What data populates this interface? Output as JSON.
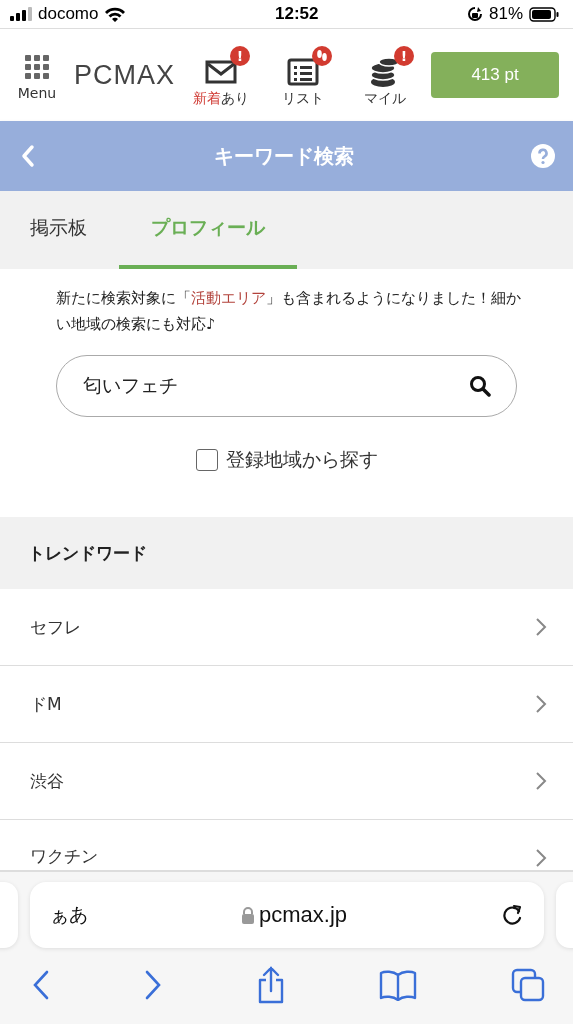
{
  "status_bar": {
    "carrier": "docomo",
    "time": "12:52",
    "battery": "81%"
  },
  "header": {
    "menu_label": "Menu",
    "logo": "PCMAX",
    "nav": [
      {
        "kind": "mail",
        "label_highlight": "新着",
        "label": "あり",
        "badge": "!"
      },
      {
        "kind": "list",
        "label": "リスト",
        "footprint_badge": true
      },
      {
        "kind": "coins",
        "label": "マイル",
        "badge": "!"
      }
    ],
    "points_button": "413 pt"
  },
  "title_bar": {
    "title": "キーワード検索"
  },
  "tabs": [
    {
      "label": "掲示板",
      "selected": false
    },
    {
      "label": "プロフィール",
      "selected": true
    }
  ],
  "notice": [
    {
      "text": "新たに検索対象に「",
      "emphasis": false
    },
    {
      "text": "活動エリア",
      "emphasis": true
    },
    {
      "text": "」も含まれるようになりました！細かい地域の検索にも対応♪",
      "emphasis": false
    }
  ],
  "search": {
    "value": "匂いフェチ"
  },
  "region_checkbox": {
    "label": "登録地域から探す",
    "checked": false
  },
  "trend": {
    "heading": "トレンドワード",
    "items": [
      "セフレ",
      "ドM",
      "渋谷",
      "ワクチン"
    ]
  },
  "browser": {
    "text_size": "ぁあ",
    "url": "pcmax.jp"
  }
}
